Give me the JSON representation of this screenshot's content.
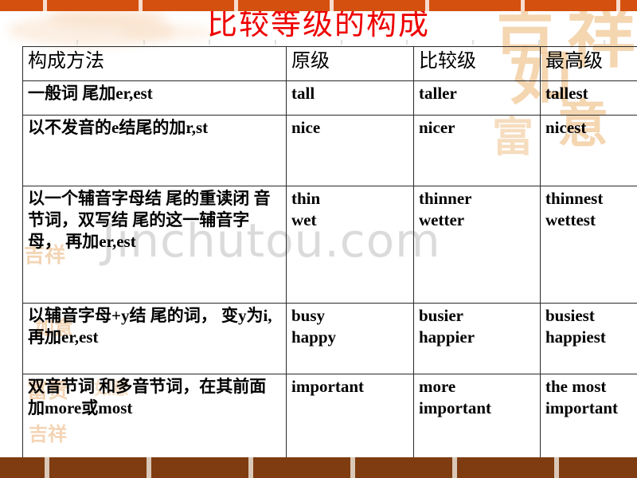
{
  "slide": {
    "title": "比较等级的构成",
    "title_color": "#EE0000",
    "top_bar_color": "#D4500E",
    "bottom_bar_color": "#7E3C10",
    "watermark": "Jinchutou.com",
    "decor": {
      "calligraphy": [
        "吉",
        "祥",
        "如",
        "意",
        "富"
      ],
      "stamps": [
        "吉祥",
        "如意",
        "富贵"
      ]
    }
  },
  "table": {
    "headers": [
      "构成方法",
      "原级",
      "比较级",
      "最高级"
    ],
    "rows": [
      {
        "method_plain": "一般词尾加er,est",
        "method_parts": [
          {
            "t": "一般",
            "b": false
          },
          {
            "t": "词",
            "b": true
          },
          {
            "t": " 尾加",
            "b": false
          },
          {
            "t": "er,est",
            "b": false,
            "en": true
          }
        ],
        "positive": "tall",
        "comparative": "taller",
        "superlative": "tallest"
      },
      {
        "method_plain": "以不发音的e结尾的加r,st",
        "method_parts": [
          {
            "t": "以不",
            "b": false
          },
          {
            "t": "发",
            "b": true
          },
          {
            "t": "音的",
            "b": false
          },
          {
            "t": "e",
            "b": true,
            "en": true
          },
          {
            "t": "结",
            "b": true
          },
          {
            "t": "尾的加",
            "b": false
          },
          {
            "t": "r,st",
            "b": false,
            "en": true
          }
        ],
        "positive": "nice",
        "comparative": "nicer",
        "superlative": "nicest"
      },
      {
        "method_plain": "以一个辅音字母结尾的重读闭音节词，双写结尾的这一辅音字母，再加er,est",
        "method_parts": [
          {
            "t": "以一个",
            "b": false
          },
          {
            "t": "辅",
            "b": true
          },
          {
            "t": "音字母",
            "b": false
          },
          {
            "t": "结",
            "b": true
          },
          {
            "t": " 尾的重",
            "b": false
          },
          {
            "t": "读闭",
            "b": true
          },
          {
            "t": " 音节词，双写",
            "b": false
          },
          {
            "t": "结",
            "b": true
          },
          {
            "t": " 尾的",
            "b": false
          },
          {
            "t": "这",
            "b": true
          },
          {
            "t": "一",
            "b": false
          },
          {
            "t": "辅",
            "b": true
          },
          {
            "t": "音字母，",
            "b": false
          },
          {
            "t": " 再加",
            "b": false
          },
          {
            "t": "er,est",
            "b": false,
            "en": true
          }
        ],
        "positive": "thin\nwet",
        "comparative": "thinner\nwetter",
        "superlative": "thinnest\nwettest"
      },
      {
        "method_plain": "以辅音字母+y结尾的词，变y为i,再加er,est",
        "method_parts": [
          {
            "t": "以",
            "b": false
          },
          {
            "t": "辅",
            "b": true
          },
          {
            "t": "音字母",
            "b": false
          },
          {
            "t": "+y",
            "b": false,
            "en": true
          },
          {
            "t": "结",
            "b": true
          },
          {
            "t": " 尾的",
            "b": false
          },
          {
            "t": "词",
            "b": true
          },
          {
            "t": "，  ",
            "b": false
          },
          {
            "t": "变",
            "b": true
          },
          {
            "t": "y",
            "b": true,
            "en": true
          },
          {
            "t": "为",
            "b": true
          },
          {
            "t": "i,",
            "b": false,
            "en": true
          },
          {
            "t": "再加",
            "b": false
          },
          {
            "t": "er,est",
            "b": false,
            "en": true
          }
        ],
        "positive": "busy\nhappy",
        "comparative": "busier\nhappier",
        "superlative": "busiest\nhappiest"
      },
      {
        "method_plain": "双音节词和多音节词，在其前面加more或most",
        "method_parts": [
          {
            "t": "双音",
            "b": false
          },
          {
            "t": "节词",
            "b": true
          },
          {
            "t": " 和多音",
            "b": false
          },
          {
            "t": "节词",
            "b": true
          },
          {
            "t": "，",
            "b": false
          },
          {
            "t": "在其前面加",
            "b": false
          },
          {
            "t": "more",
            "b": false,
            "en": true
          },
          {
            "t": "或",
            "b": false
          },
          {
            "t": "most",
            "b": false,
            "en": true
          }
        ],
        "positive": "important",
        "comparative": "more\nimportant",
        "superlative": "the most\nimportant"
      }
    ]
  }
}
